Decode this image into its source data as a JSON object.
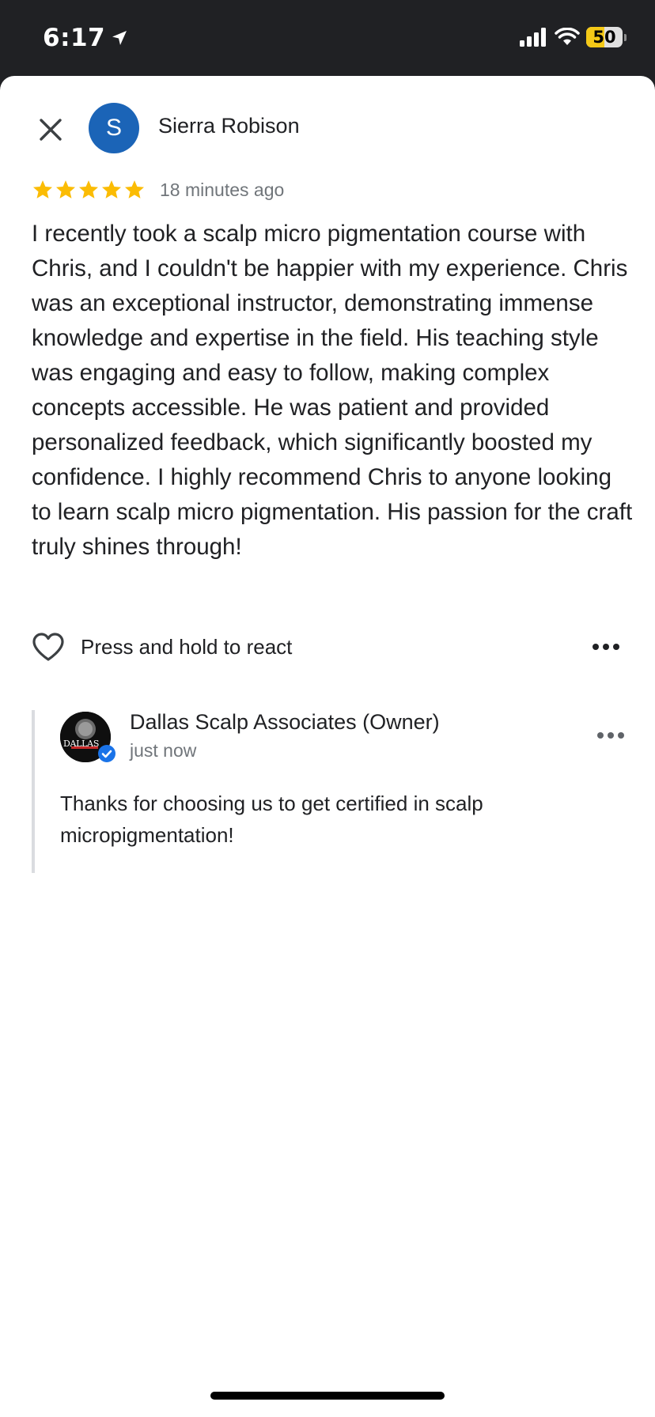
{
  "status_bar": {
    "time": "6:17",
    "battery": "50",
    "battery_level_percent": 50,
    "colors": {
      "battery": "#f4c917"
    },
    "icons": [
      "location-arrow-icon",
      "signal-icon",
      "wifi-icon",
      "battery-icon"
    ]
  },
  "review": {
    "avatar_initial": "S",
    "reviewer_name": "Sierra Robison",
    "rating": 5,
    "time_ago": "18 minutes ago",
    "text": "I recently took a scalp micro pigmentation course with Chris, and I couldn't be happier with my experience. Chris was an exceptional instructor, demonstrating immense knowledge and expertise in the field. His teaching style was engaging and easy to follow, making complex concepts accessible. He was patient and provided personalized feedback, which significantly boosted my confidence. I highly recommend Chris to anyone looking to learn scalp micro pigmentation. His passion for the craft truly shines through!",
    "react_label": "Press and hold to react",
    "colors": {
      "avatar": "#1b64b7",
      "star": "#fbbc04"
    }
  },
  "owner_reply": {
    "name": "Dallas Scalp Associates (Owner)",
    "time": "just now",
    "logo_text": "DALLAS",
    "text": "Thanks for choosing us to get certified in scalp micropigmentation!",
    "colors": {
      "verified": "#1a73e8"
    }
  }
}
